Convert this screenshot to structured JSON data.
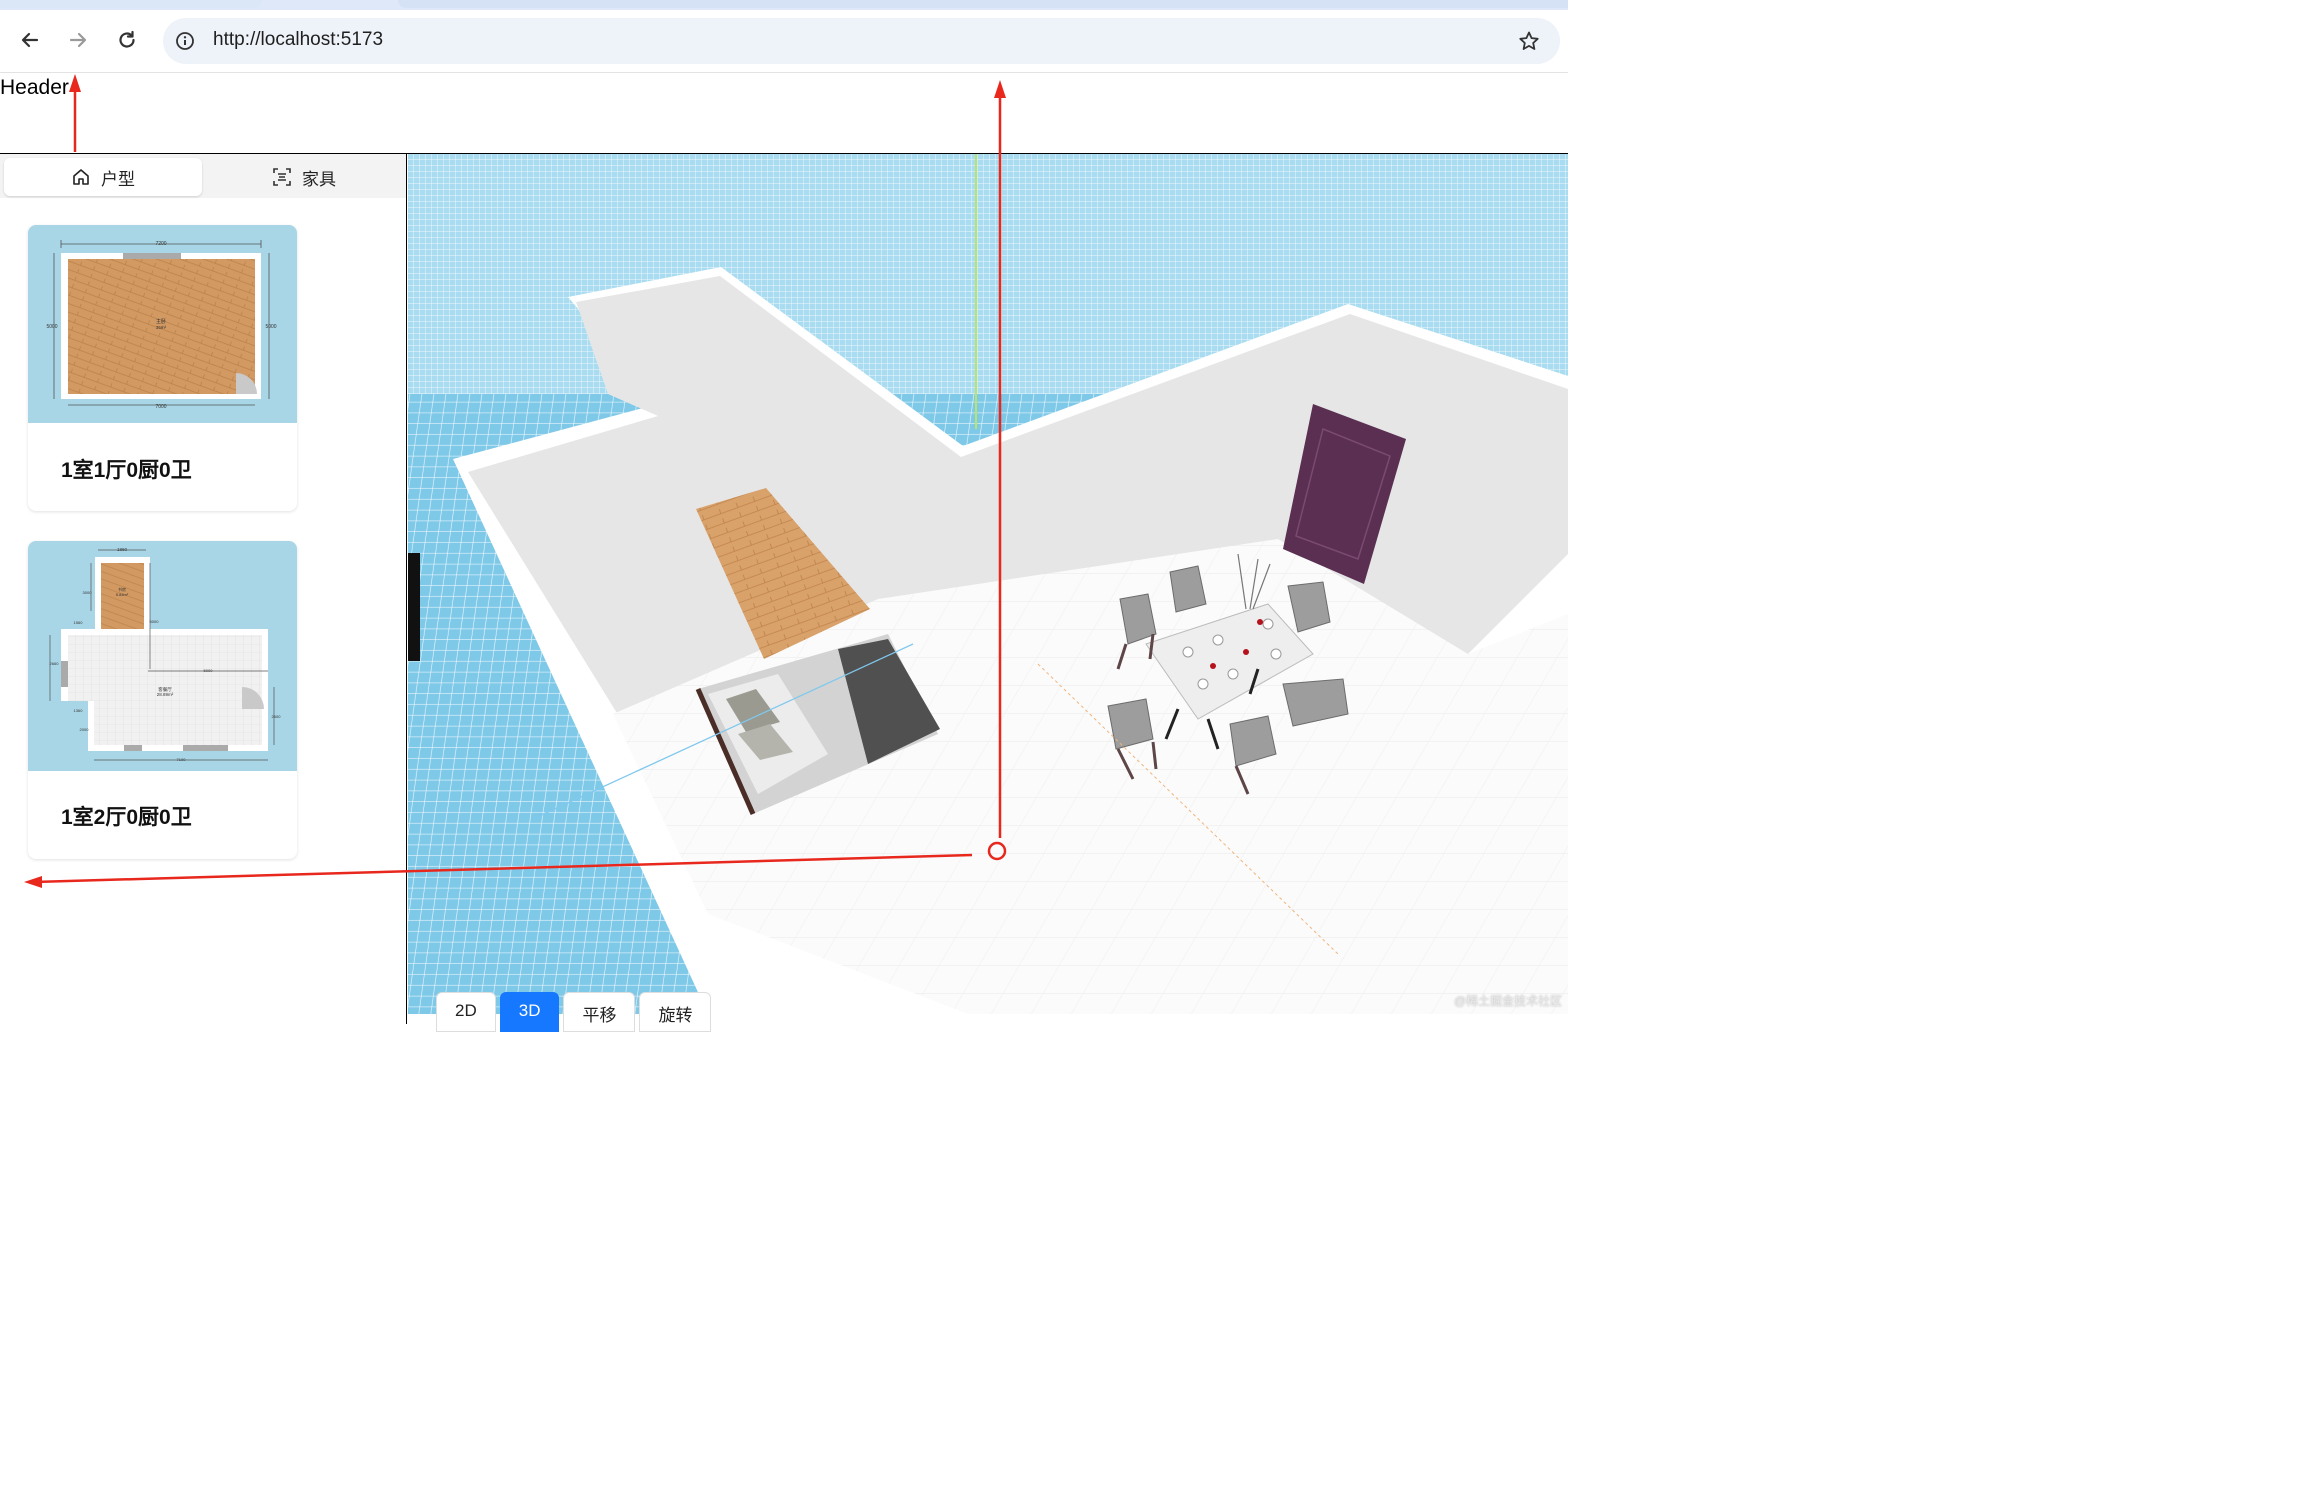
{
  "browser": {
    "url": "http://localhost:5173",
    "icons": [
      "back-arrow-icon",
      "forward-arrow-icon",
      "reload-icon",
      "info-icon",
      "star-icon"
    ]
  },
  "header": {
    "label": "Header"
  },
  "sidebar": {
    "tabs": [
      {
        "label": "户型",
        "icon": "home-icon",
        "active": true
      },
      {
        "label": "家具",
        "icon": "scan-icon",
        "active": false
      }
    ],
    "cards": [
      {
        "title": "1室1厅0厨0卫",
        "plan": {
          "top_dim": "7200",
          "bottom_dim": "7000",
          "left_dim": "5000",
          "right_dim": "5000",
          "room_label": "主卧",
          "room_area": "35m²"
        }
      },
      {
        "title": "1室2厅0厨0卫",
        "plan": {
          "top_dim": "1860",
          "dim_a": "3000",
          "dim_b": "1560",
          "dim_c": "5000",
          "dim_d": "2660",
          "dim_e": "5000",
          "dim_f": "1360",
          "dim_g": "2000",
          "dim_h": "2600",
          "bottom_dim": "7100",
          "room1_label": "书房",
          "room1_area": "5.84m²",
          "room2_label": "客餐厅",
          "room2_area": "28.89m²"
        }
      }
    ]
  },
  "viewport": {
    "view_tabs": [
      {
        "label": "2D",
        "active": false
      },
      {
        "label": "3D",
        "active": true
      },
      {
        "label": "平移",
        "active": false
      },
      {
        "label": "旋转",
        "active": false
      }
    ],
    "watermark": "@稀土掘金技术社区",
    "colors": {
      "grid_bg": "#6bbde0",
      "floor": "#e6e6e6",
      "wall_top": "#ffffff",
      "wood": "#d9a26b",
      "door": "#5a2f52",
      "annotation": "#e8271d"
    }
  }
}
